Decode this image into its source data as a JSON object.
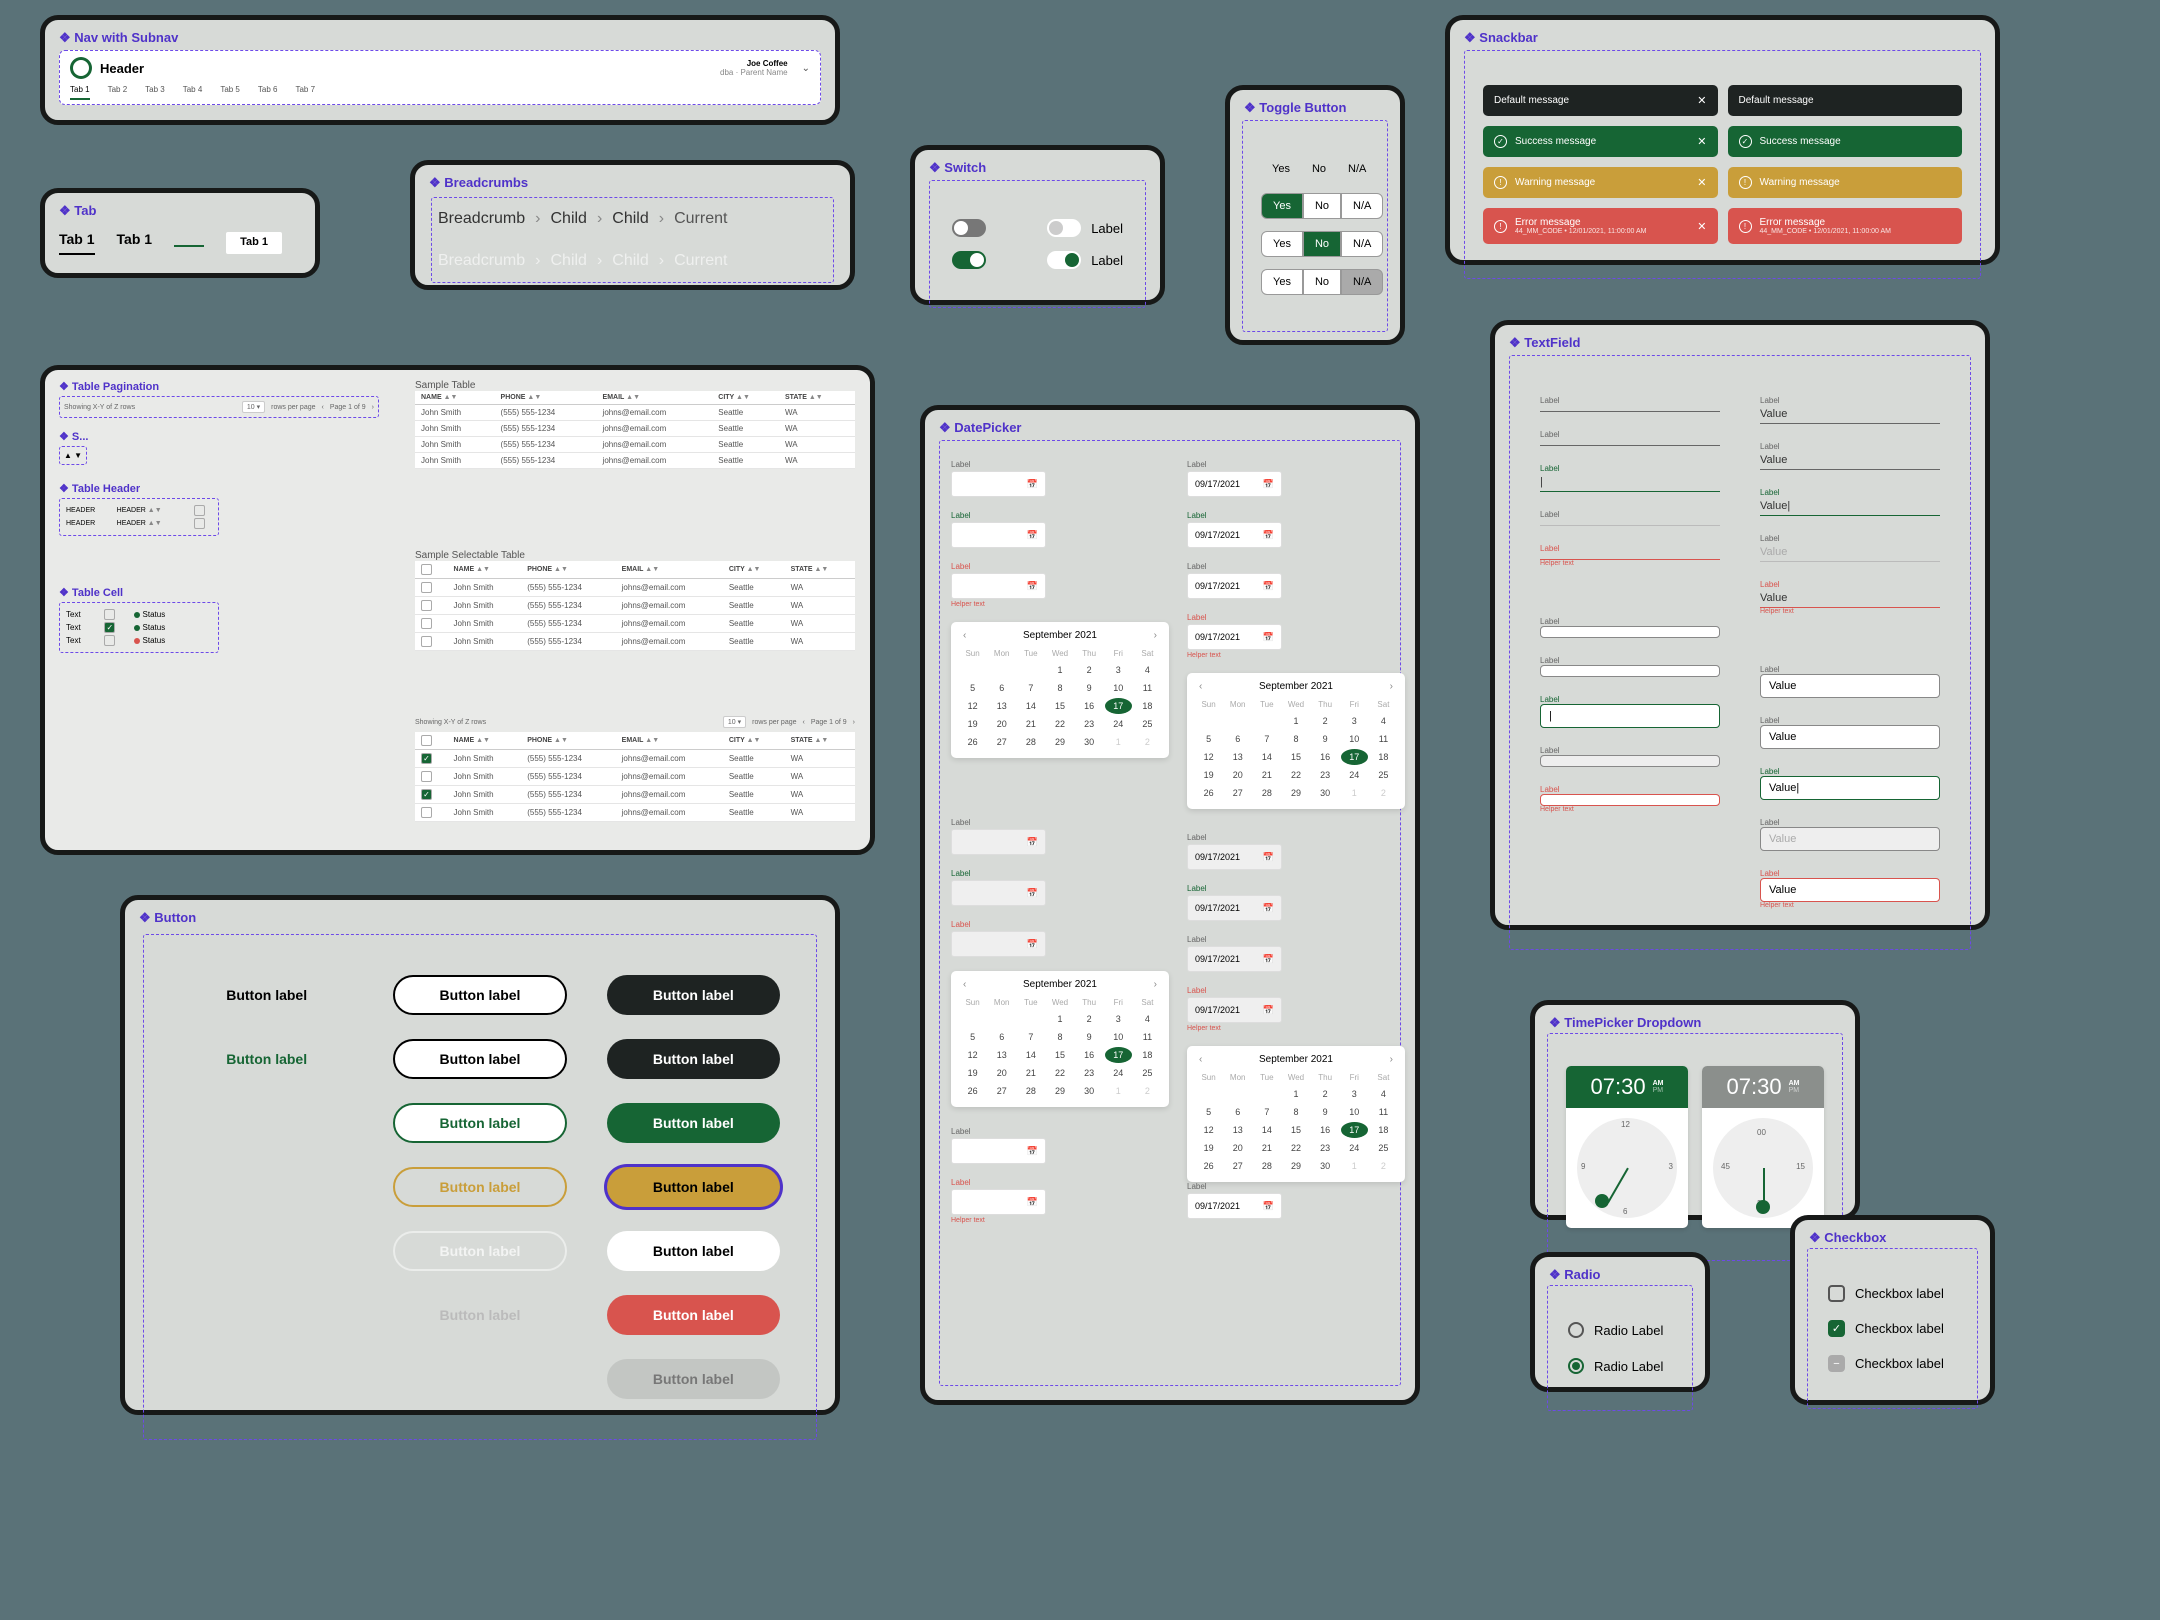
{
  "nav": {
    "title": "Nav with Subnav",
    "header": "Header",
    "user": {
      "name": "Joe Coffee",
      "subtitle": "dba · Parent Name"
    },
    "tabs": [
      "Tab 1",
      "Tab 2",
      "Tab 3",
      "Tab 4",
      "Tab 5",
      "Tab 6",
      "Tab 7"
    ]
  },
  "tab": {
    "title": "Tab",
    "items": [
      "Tab 1",
      "Tab 1",
      "Tab 1"
    ]
  },
  "breadcrumbs": {
    "title": "Breadcrumbs",
    "parts": [
      "Breadcrumb",
      "Child",
      "Child",
      "Current"
    ]
  },
  "switch": {
    "title": "Switch",
    "label": "Label"
  },
  "toggle": {
    "title": "Toggle Button",
    "options": [
      "Yes",
      "No",
      "N/A"
    ]
  },
  "snackbar": {
    "title": "Snackbar",
    "default": "Default message",
    "success": "Success message",
    "warning": "Warning message",
    "error": "Error message",
    "error_sub": "44_MM_CODE • 12/01/2021, 11:00:00 AM"
  },
  "table": {
    "pagination_title": "Table Pagination",
    "showing": "Showing X-Y of Z rows",
    "rows_per_page": "rows per page",
    "rpp_value": "10",
    "page_of": "Page 1 of 9",
    "s_title": "S...",
    "header_title": "Table Header",
    "header_label": "HEADER",
    "cell_title": "Table Cell",
    "cell_text": "Text",
    "cell_status": "Status",
    "sample_title": "Sample Table",
    "sample_sel_title": "Sample Selectable Table",
    "cols": [
      "NAME",
      "PHONE",
      "EMAIL",
      "CITY",
      "STATE"
    ],
    "rows": [
      {
        "name": "John Smith",
        "phone": "(555) 555-1234",
        "email": "johns@email.com",
        "city": "Seattle",
        "state": "WA"
      },
      {
        "name": "John Smith",
        "phone": "(555) 555-1234",
        "email": "johns@email.com",
        "city": "Seattle",
        "state": "WA"
      },
      {
        "name": "John Smith",
        "phone": "(555) 555-1234",
        "email": "johns@email.com",
        "city": "Seattle",
        "state": "WA"
      },
      {
        "name": "John Smith",
        "phone": "(555) 555-1234",
        "email": "johns@email.com",
        "city": "Seattle",
        "state": "WA"
      }
    ]
  },
  "button": {
    "title": "Button",
    "label": "Button label"
  },
  "datepicker": {
    "title": "DatePicker",
    "label": "Label",
    "value": "09/17/2021",
    "helper": "Helper text",
    "month": "September 2021",
    "dow": [
      "Sun",
      "Mon",
      "Tue",
      "Wed",
      "Thu",
      "Fri",
      "Sat"
    ],
    "lead": 3,
    "days": 30,
    "selected": 17,
    "trail": [
      1,
      2
    ]
  },
  "textfield": {
    "title": "TextField",
    "label": "Label",
    "value": "Value",
    "helper": "Helper text"
  },
  "timepicker": {
    "title": "TimePicker Dropdown",
    "time": "07:30",
    "am": "AM",
    "pm": "PM",
    "ticks": [
      "12",
      "3",
      "6",
      "9"
    ]
  },
  "radio": {
    "title": "Radio",
    "label": "Radio Label"
  },
  "checkbox": {
    "title": "Checkbox",
    "label": "Checkbox label"
  }
}
